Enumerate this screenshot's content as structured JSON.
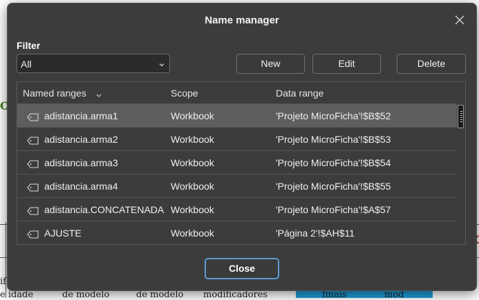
{
  "dialog": {
    "title": "Name manager",
    "filter_label": "Filter",
    "filter_value": "All",
    "buttons": {
      "new": "New",
      "edit": "Edit",
      "delete": "Delete",
      "close": "Close"
    }
  },
  "table": {
    "headers": {
      "name": "Named ranges",
      "scope": "Scope",
      "range": "Data range"
    },
    "rows": [
      {
        "name": "adistancia.arma1",
        "scope": "Workbook",
        "range": "'Projeto MicroFicha'!$B$52",
        "selected": true
      },
      {
        "name": "adistancia.arma2",
        "scope": "Workbook",
        "range": "'Projeto MicroFicha'!$B$53"
      },
      {
        "name": "adistancia.arma3",
        "scope": "Workbook",
        "range": "'Projeto MicroFicha'!$B$54"
      },
      {
        "name": "adistancia.arma4",
        "scope": "Workbook",
        "range": "'Projeto MicroFicha'!$B$55"
      },
      {
        "name": "adistancia.CONCATENADA",
        "scope": "Workbook",
        "range": "'Projeto MicroFicha'!$A$57"
      },
      {
        "name": "AJUSTE",
        "scope": "Workbook",
        "range": "'Página 2'!$AH$11"
      }
    ]
  },
  "background": {
    "cells": [
      "e idade",
      "de modelo",
      "de modelo",
      "modificadores",
      "finais",
      "mod"
    ],
    "left_fragment": "if"
  },
  "colors": {
    "accent": "#5b9bd5",
    "dialog_bg": "#3c3c3c",
    "selected_row": "#5e5e5e"
  },
  "icons": {
    "close": "close-icon",
    "dropdown": "chevron-down-icon",
    "sort": "sort-down-icon",
    "name_tag": "tag-icon"
  }
}
